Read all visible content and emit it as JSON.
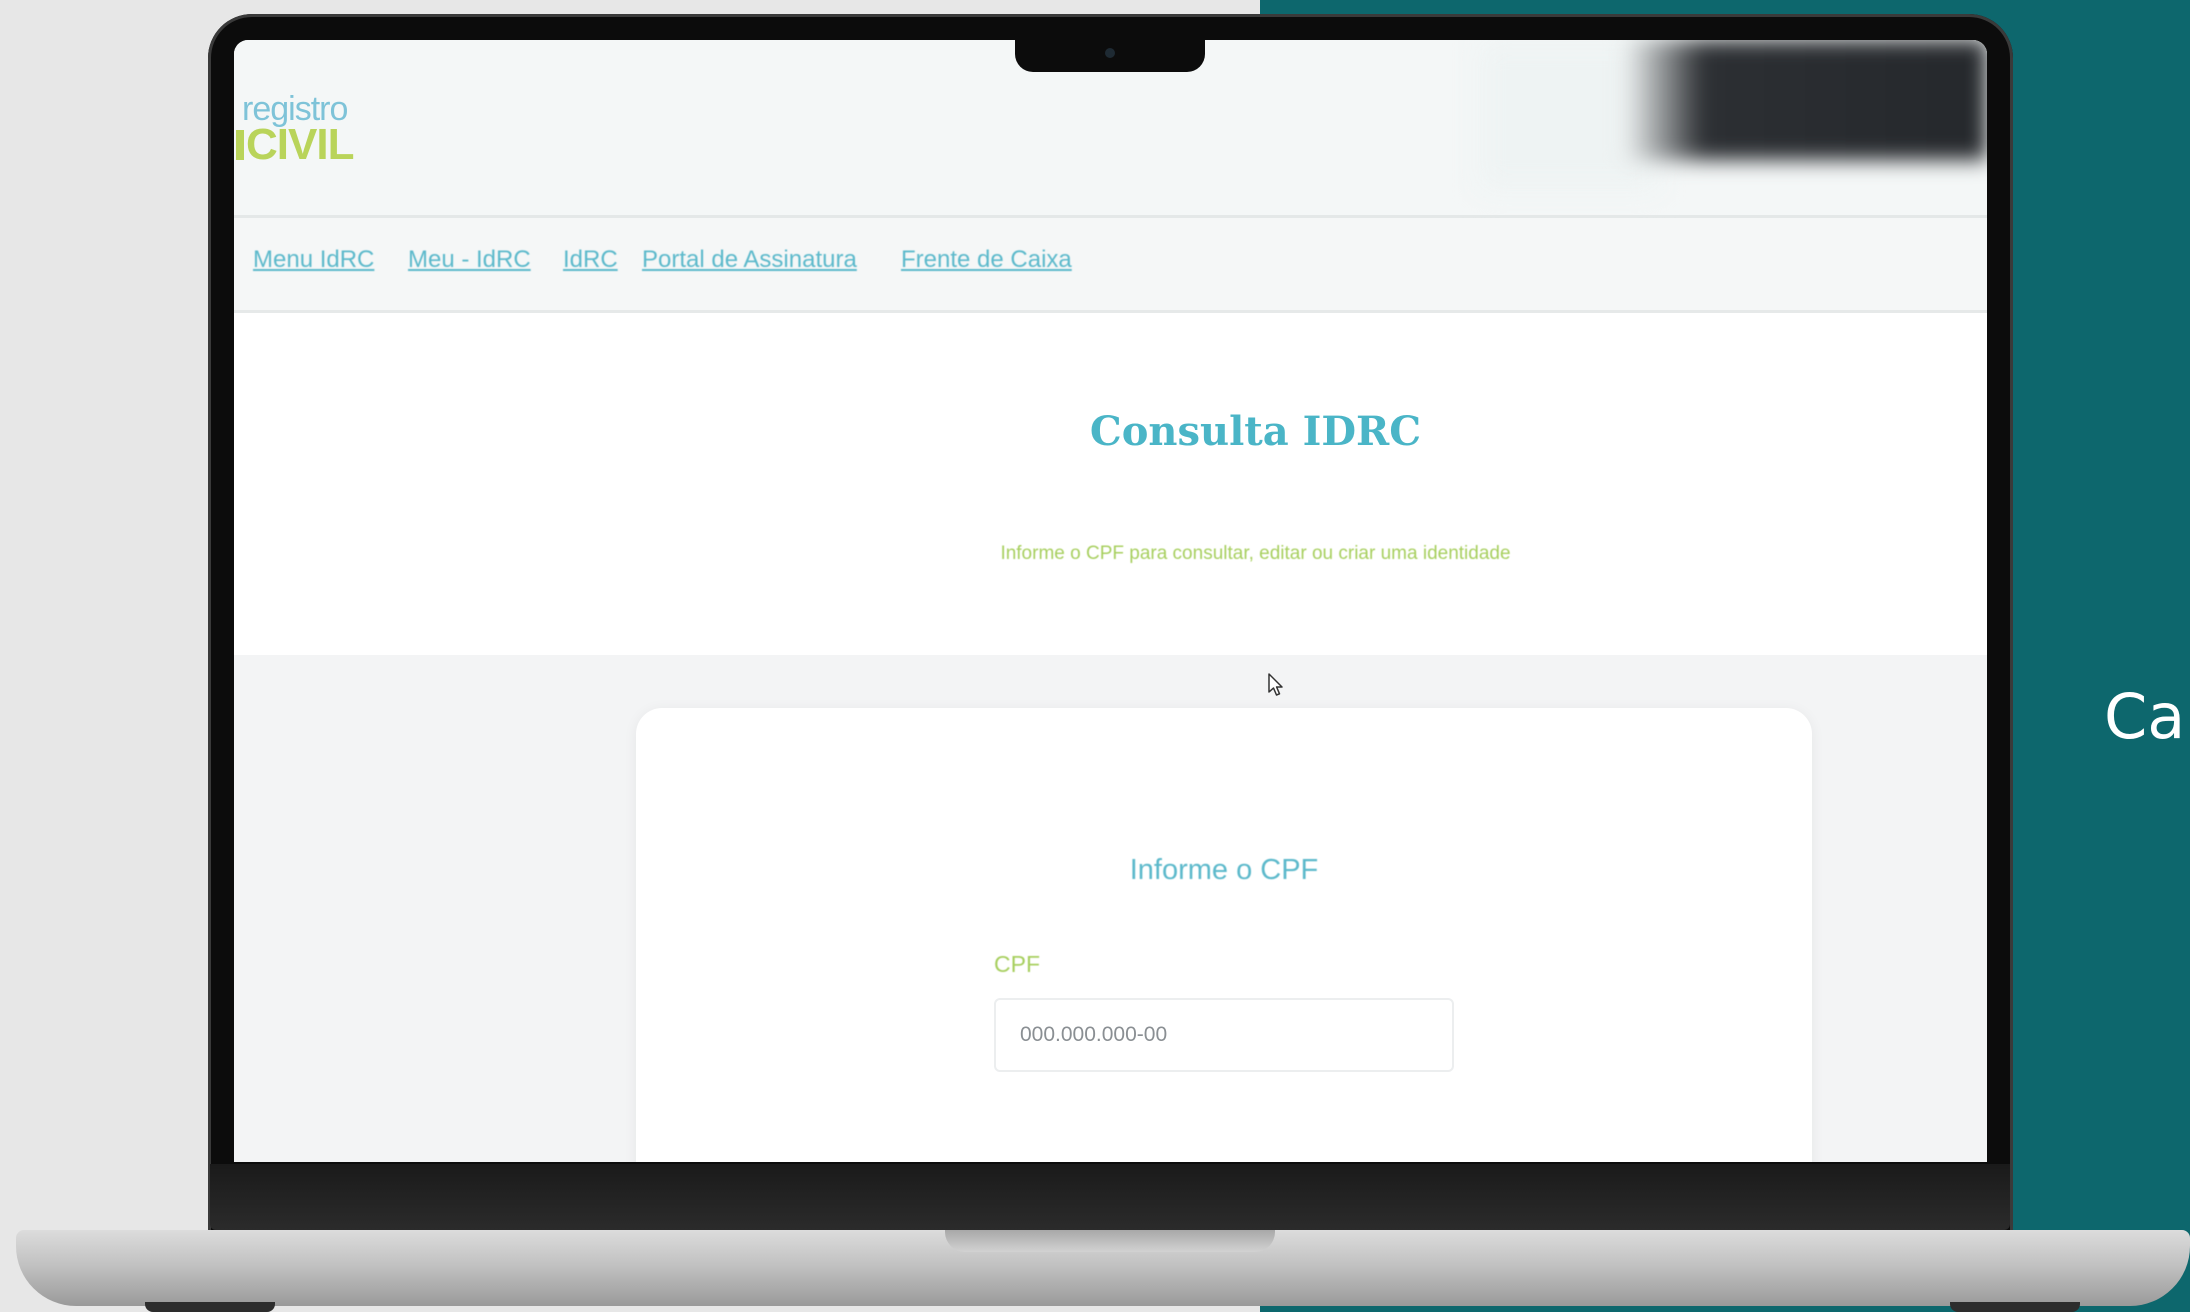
{
  "colors": {
    "background_left": "#e7e7e7",
    "background_right": "#0d676d",
    "brand_teal": "#4ab5c7",
    "brand_green": "#a7cf5e"
  },
  "side_text": "Ca",
  "header": {
    "logo": {
      "line1": "registro",
      "line2": "CIVIL"
    }
  },
  "nav": {
    "links": [
      {
        "label": "Menu IdRC"
      },
      {
        "label": "Meu - IdRC"
      },
      {
        "label": "IdRC"
      },
      {
        "label": "Portal de Assinatura"
      },
      {
        "label": "Frente de Caixa"
      }
    ]
  },
  "hero": {
    "title": "Consulta IDRC",
    "subtitle": "Informe o CPF para consultar, editar ou criar uma identidade"
  },
  "form": {
    "title": "Informe o CPF",
    "cpf_label": "CPF",
    "cpf_placeholder": "000.000.000-00",
    "cpf_value": ""
  },
  "icons": {
    "cursor": "mouse-pointer-icon",
    "camera": "webcam-icon"
  }
}
